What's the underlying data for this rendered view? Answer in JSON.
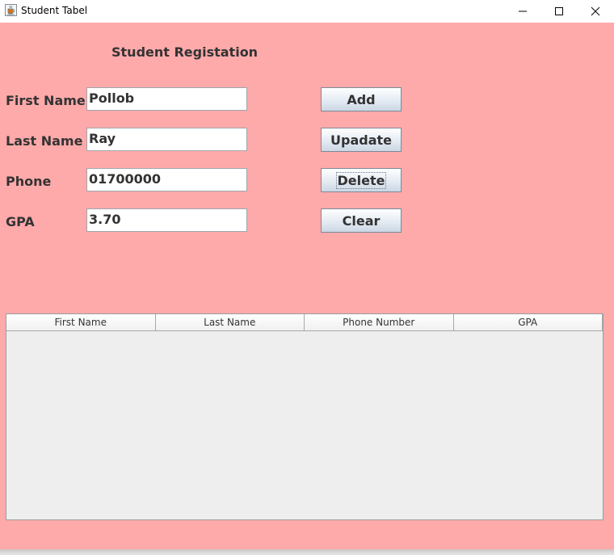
{
  "window": {
    "title": "Student Tabel"
  },
  "form": {
    "heading": "Student Registation",
    "first_name_label": "First Name",
    "first_name_value": "Pollob",
    "last_name_label": "Last Name",
    "last_name_value": "Ray",
    "phone_label": "Phone",
    "phone_value": "01700000",
    "gpa_label": "GPA",
    "gpa_value": "3.70"
  },
  "buttons": {
    "add": "Add",
    "update": "Upadate",
    "delete": "Delete",
    "clear": "Clear"
  },
  "table": {
    "columns": [
      "First Name",
      "Last Name",
      "Phone Number",
      "GPA"
    ],
    "rows": []
  },
  "colors": {
    "background": "#ffaaaa",
    "text": "#333333"
  },
  "icons": {
    "app": "java-cup-icon",
    "minimize": "minimize-icon",
    "maximize": "maximize-icon",
    "close": "close-icon"
  }
}
